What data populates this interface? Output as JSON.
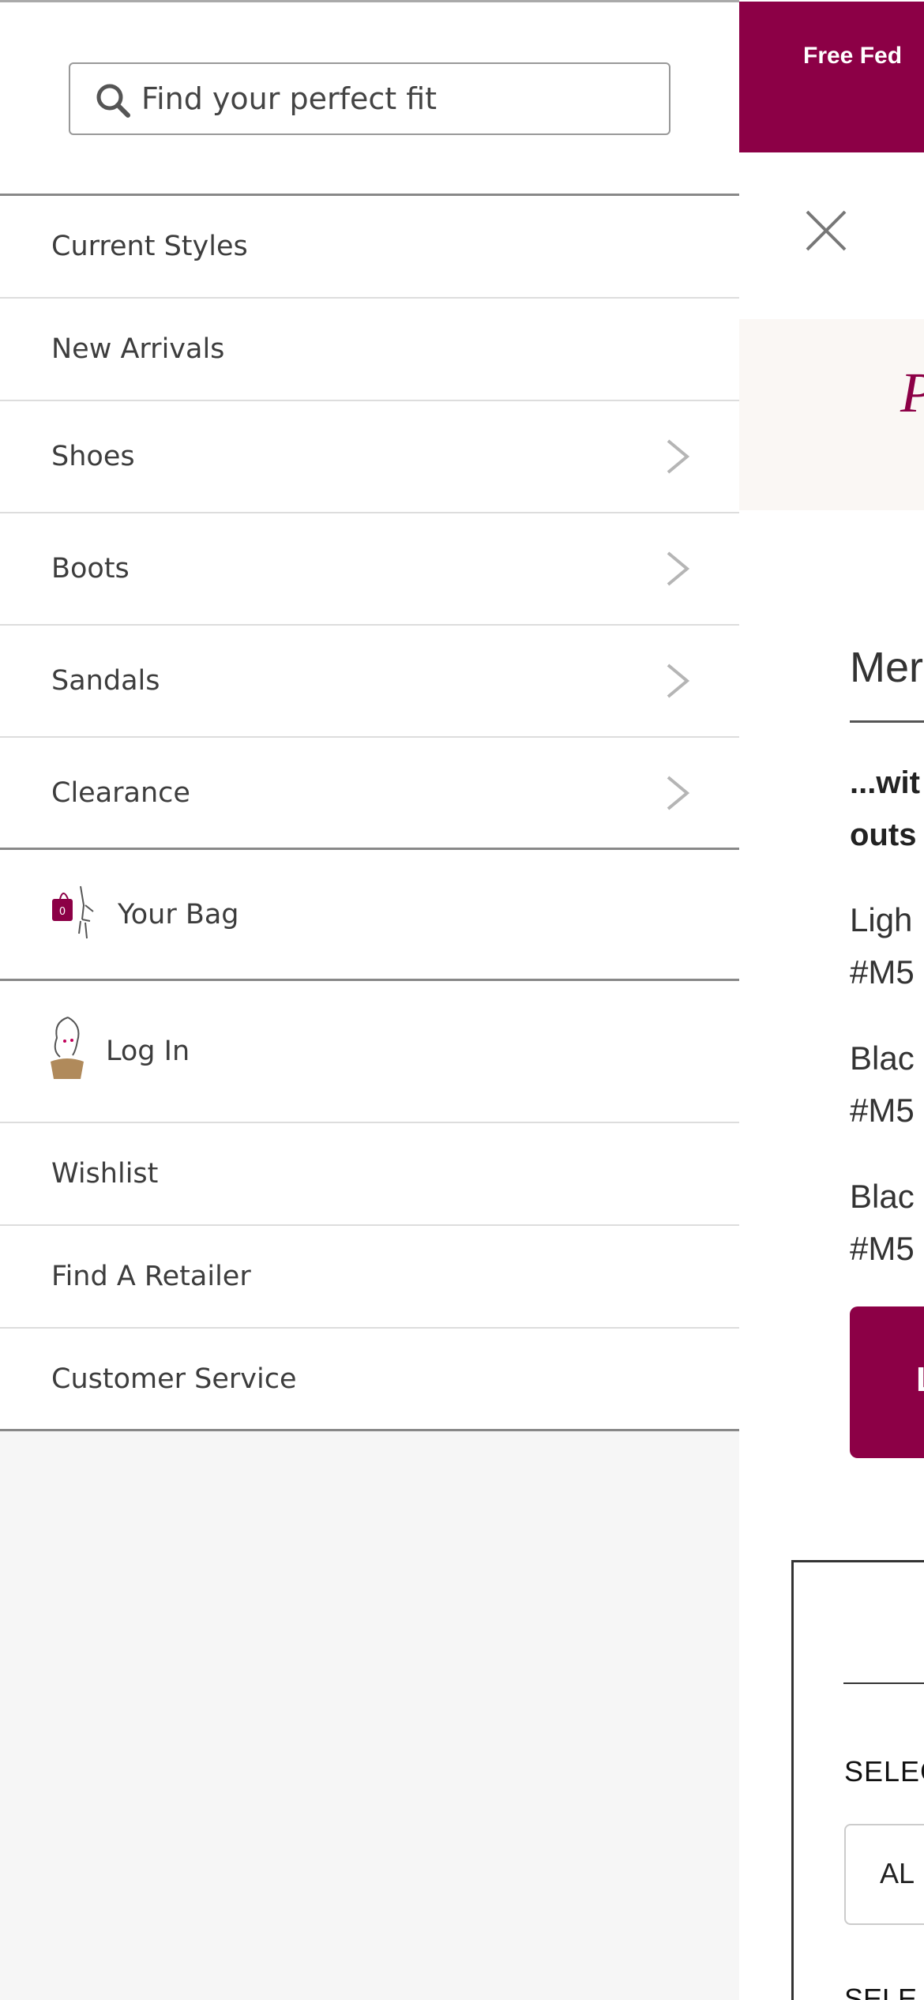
{
  "background_page": {
    "promo_text": "Free Fed",
    "banner_text": "P",
    "product_heading": "Mer",
    "product_description_lines": [
      "...wit",
      "outs"
    ],
    "variants": [
      {
        "name": "Ligh",
        "sku": "#M5"
      },
      {
        "name": "Blac",
        "sku": "#M5"
      },
      {
        "name": "Blac",
        "sku": "#M5"
      }
    ],
    "add_button_label": "L",
    "select_label": "SELEC",
    "select_value": "AL",
    "select_label_2": "SELE",
    "colors": {
      "brand": "#8c0046",
      "banner_bg": "#faf7f4"
    }
  },
  "drawer": {
    "search": {
      "placeholder": "Find your perfect fit"
    },
    "categories": [
      {
        "label": "Current Styles",
        "has_submenu": false
      },
      {
        "label": "New Arrivals",
        "has_submenu": false
      },
      {
        "label": "Shoes",
        "has_submenu": true
      },
      {
        "label": "Boots",
        "has_submenu": true
      },
      {
        "label": "Sandals",
        "has_submenu": true
      },
      {
        "label": "Clearance",
        "has_submenu": true
      }
    ],
    "bag": {
      "label": "Your Bag",
      "count": "0"
    },
    "account": [
      {
        "label": "Log In"
      },
      {
        "label": "Wishlist"
      },
      {
        "label": "Find A Retailer"
      },
      {
        "label": "Customer Service"
      }
    ]
  }
}
